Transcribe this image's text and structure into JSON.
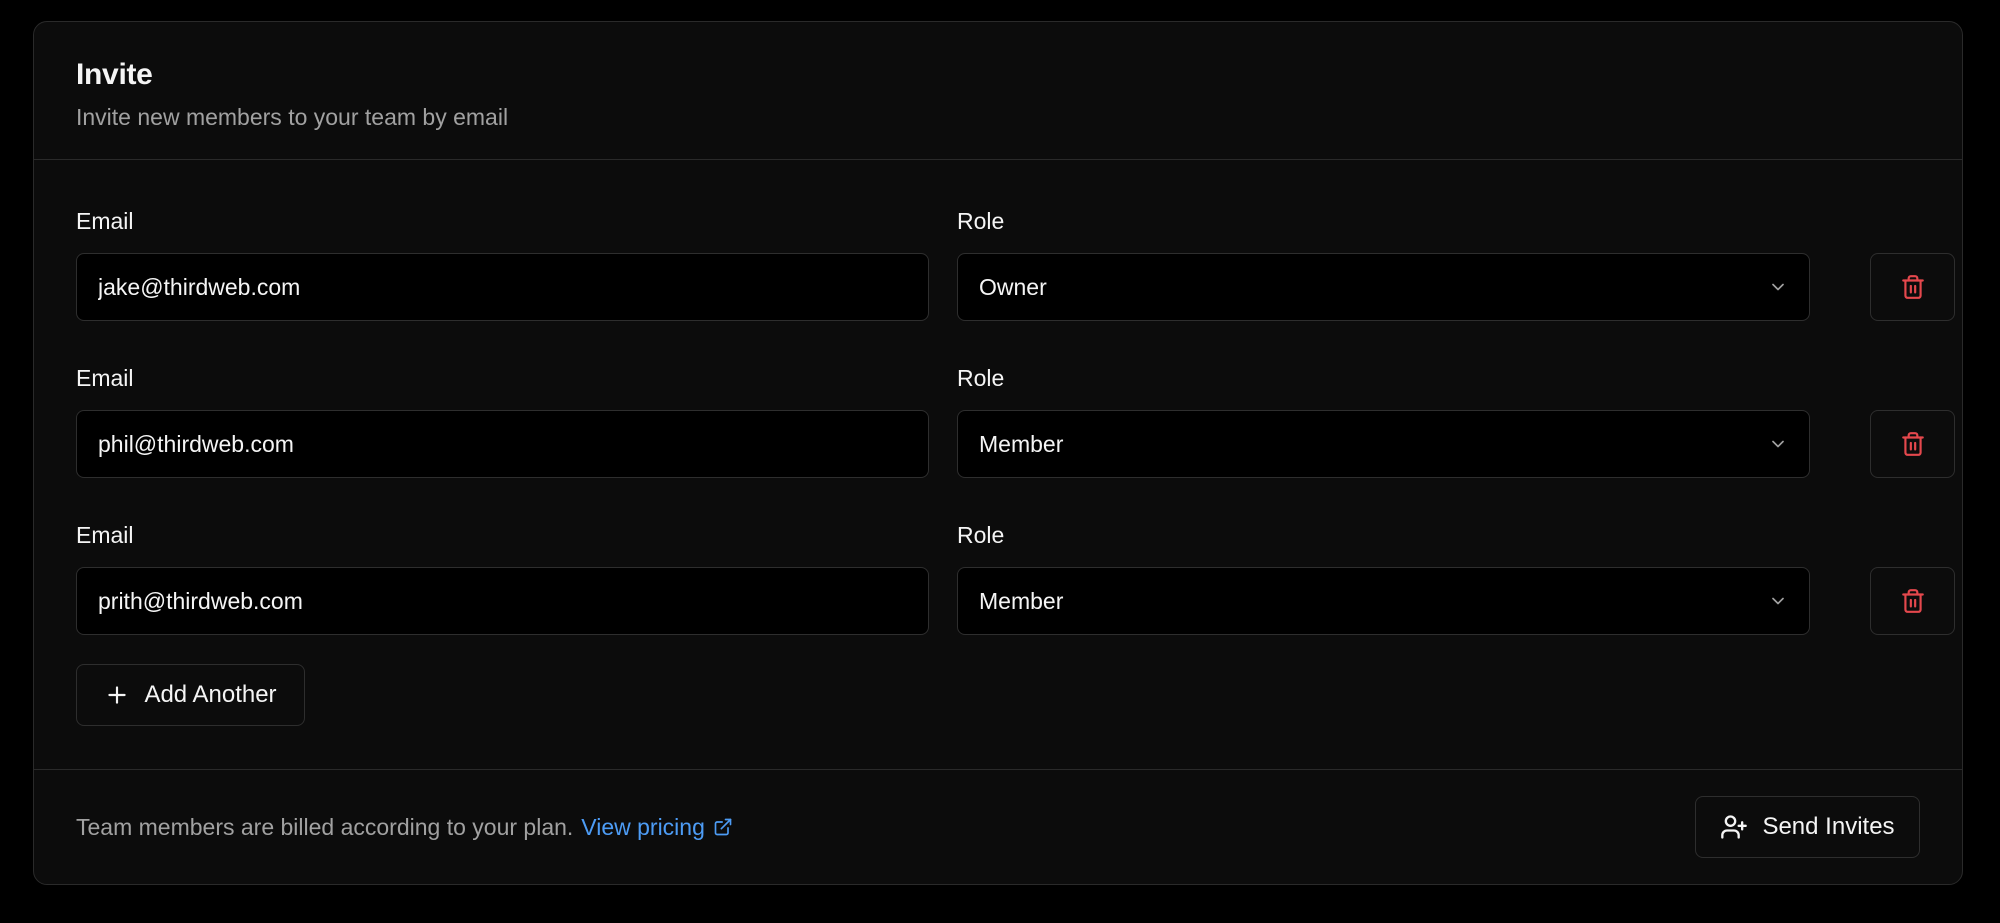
{
  "header": {
    "title": "Invite",
    "subtitle": "Invite new members to your team by email"
  },
  "invites": [
    {
      "email_label": "Email",
      "email": "jake@thirdweb.com",
      "role_label": "Role",
      "role": "Owner"
    },
    {
      "email_label": "Email",
      "email": "phil@thirdweb.com",
      "role_label": "Role",
      "role": "Member"
    },
    {
      "email_label": "Email",
      "email": "prith@thirdweb.com",
      "role_label": "Role",
      "role": "Member"
    }
  ],
  "add_button": {
    "label": "Add Another",
    "icon": "plus-icon"
  },
  "footer": {
    "note": "Team members are billed according to your plan.",
    "link_label": "View pricing",
    "link_icon": "external-link-icon",
    "send_label": "Send Invites",
    "send_icon": "user-plus-icon"
  },
  "colors": {
    "background": "#000000",
    "card": "#0c0c0c",
    "border": "#2a2a2a",
    "muted_text": "#a1a1a1",
    "link": "#4d9cf5",
    "danger": "#e5484d"
  },
  "icons": {
    "delete": "trash-icon",
    "select": "chevron-down-icon"
  }
}
